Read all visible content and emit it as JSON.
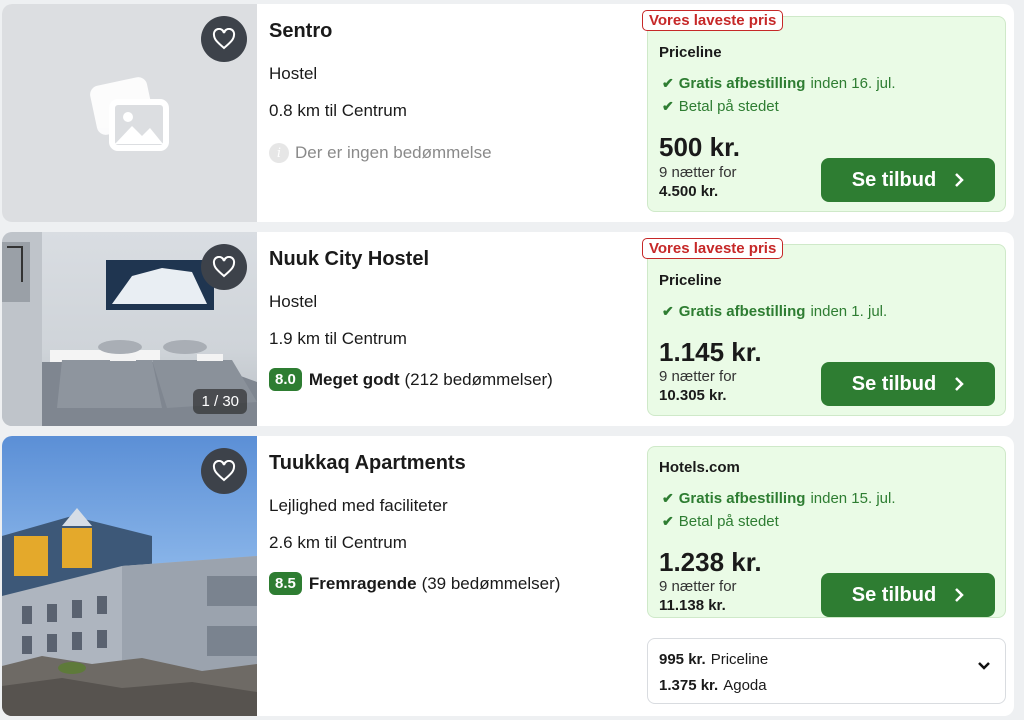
{
  "listings": [
    {
      "name": "Sentro",
      "type": "Hostel",
      "distance": "0.8 km til Centrum",
      "no_rating": "Der er ingen bedømmelse",
      "lowest_label": "Vores laveste pris",
      "provider": "Priceline",
      "perk1_bold": "Gratis afbestilling",
      "perk1_rest": "inden 16. jul.",
      "perk2": "Betal på stedet",
      "price": "500 kr.",
      "nights": "9 nætter for",
      "total": "4.500 kr.",
      "cta": "Se tilbud"
    },
    {
      "name": "Nuuk City Hostel",
      "type": "Hostel",
      "distance": "1.9 km til Centrum",
      "score": "8.0",
      "score_label": "Meget godt",
      "reviews": "(212 bedømmelser)",
      "photo_counter": "1 / 30",
      "lowest_label": "Vores laveste pris",
      "provider": "Priceline",
      "perk1_bold": "Gratis afbestilling",
      "perk1_rest": "inden 1. jul.",
      "price": "1.145 kr.",
      "nights": "9 nætter for",
      "total": "10.305 kr.",
      "cta": "Se tilbud"
    },
    {
      "name": "Tuukkaq Apartments",
      "type": "Lejlighed med faciliteter",
      "distance": "2.6 km til Centrum",
      "score": "8.5",
      "score_label": "Fremragende",
      "reviews": "(39 bedømmelser)",
      "provider": "Hotels.com",
      "perk1_bold": "Gratis afbestilling",
      "perk1_rest": "inden 15. jul.",
      "perk2": "Betal på stedet",
      "price": "1.238 kr.",
      "nights": "9 nætter for",
      "total": "11.138 kr.",
      "cta": "Se tilbud",
      "alternatives": [
        {
          "price": "995 kr.",
          "provider": "Priceline"
        },
        {
          "price": "1.375 kr.",
          "provider": "Agoda"
        }
      ]
    }
  ],
  "colors": {
    "accent_green": "#2e7d32",
    "deal_bg": "#eafbe6",
    "lowest_red": "#c62828"
  }
}
